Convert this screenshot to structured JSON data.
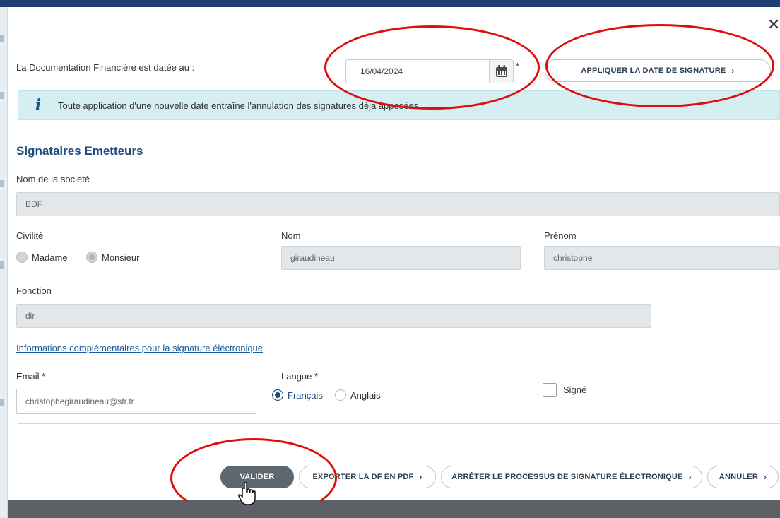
{
  "dialog": {
    "close_label": "✕",
    "date_label": "La Documentation Financière est datée au :",
    "date_value": "16/04/2024",
    "date_required_mark": "*",
    "apply_button": "APPLIQUER LA DATE DE SIGNATURE",
    "info_message": "Toute application d'une nouvelle date entraîne l'annulation des signatures déja apposées",
    "section_title": "Signataires Emetteurs",
    "company_label": "Nom de la societé",
    "company_value": "BDF",
    "civility_label": "Civilité",
    "civility_options": [
      "Madame",
      "Monsieur"
    ],
    "civility_selected": "Monsieur",
    "last_name_label": "Nom",
    "last_name_value": "giraudineau",
    "first_name_label": "Prénom",
    "first_name_value": "christophe",
    "function_label": "Fonction",
    "function_value": "dir",
    "info_link": "Informations complémentaires pour la signature éléctronique",
    "email_label": "Email *",
    "email_value": "christophegiraudineau@sfr.fr",
    "language_label": "Langue *",
    "language_options": [
      "Français",
      "Anglais"
    ],
    "language_selected": "Français",
    "signed_label": "Signé",
    "signed_checked": false
  },
  "footer": {
    "validate_button": "VALIDER",
    "export_button": "EXPORTER LA DF EN PDF",
    "stop_button": "ARRÊTER LE PROCESSUS DE SIGNATURE ÉLECTRONIQUE",
    "cancel_button": "ANNULER"
  },
  "icons": {
    "chevron": "›",
    "info": "i",
    "calendar": "calendar-icon",
    "cursor": "hand-pointer-icon"
  },
  "colors": {
    "accent": "#1d4a7d",
    "annotation": "#e00d0d",
    "info_bg": "#d4eef2",
    "primary_button": "#5c6770"
  }
}
